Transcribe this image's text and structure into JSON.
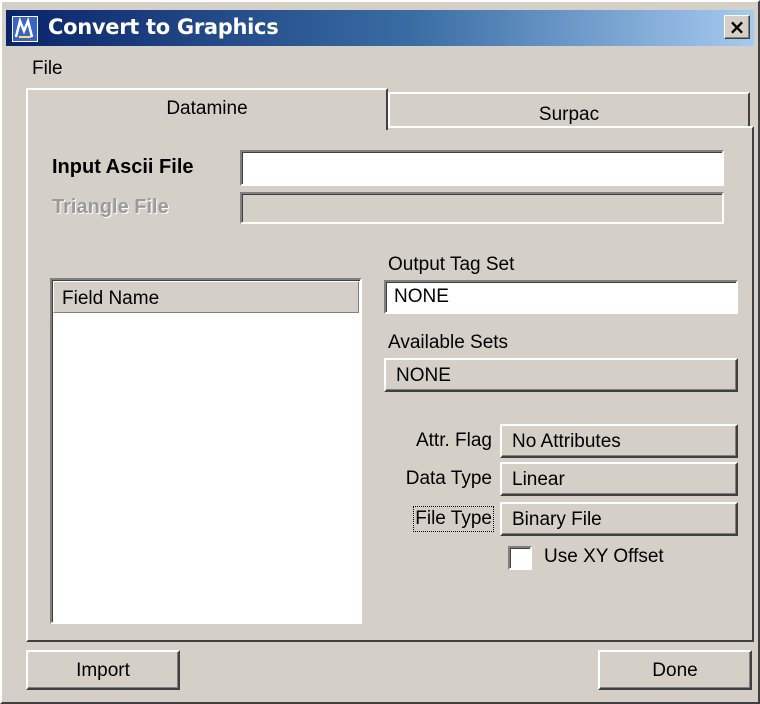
{
  "window": {
    "title": "Convert to Graphics",
    "close_label": "×",
    "titlebar_colors": [
      "#0a246a",
      "#a6caf0"
    ]
  },
  "menu": {
    "file": "File"
  },
  "tabs": [
    {
      "label": "Datamine",
      "selected": true
    },
    {
      "label": "Surpac",
      "selected": false
    }
  ],
  "form": {
    "input_ascii_label": "Input Ascii File",
    "input_ascii_value": "",
    "triangle_label": "Triangle File",
    "triangle_value": "",
    "field_list_header": "Field Name",
    "output_tag_label": "Output Tag Set",
    "output_tag_value": "NONE",
    "available_sets_label": "Available Sets",
    "available_sets_value": "NONE",
    "attr_flag_label": "Attr. Flag",
    "attr_flag_value": "No Attributes",
    "data_type_label": "Data Type",
    "data_type_value": "Linear",
    "file_type_label": "File Type",
    "file_type_value": "Binary File",
    "use_xy_label": "Use XY Offset",
    "use_xy_checked": false
  },
  "buttons": {
    "import": "Import",
    "done": "Done"
  }
}
